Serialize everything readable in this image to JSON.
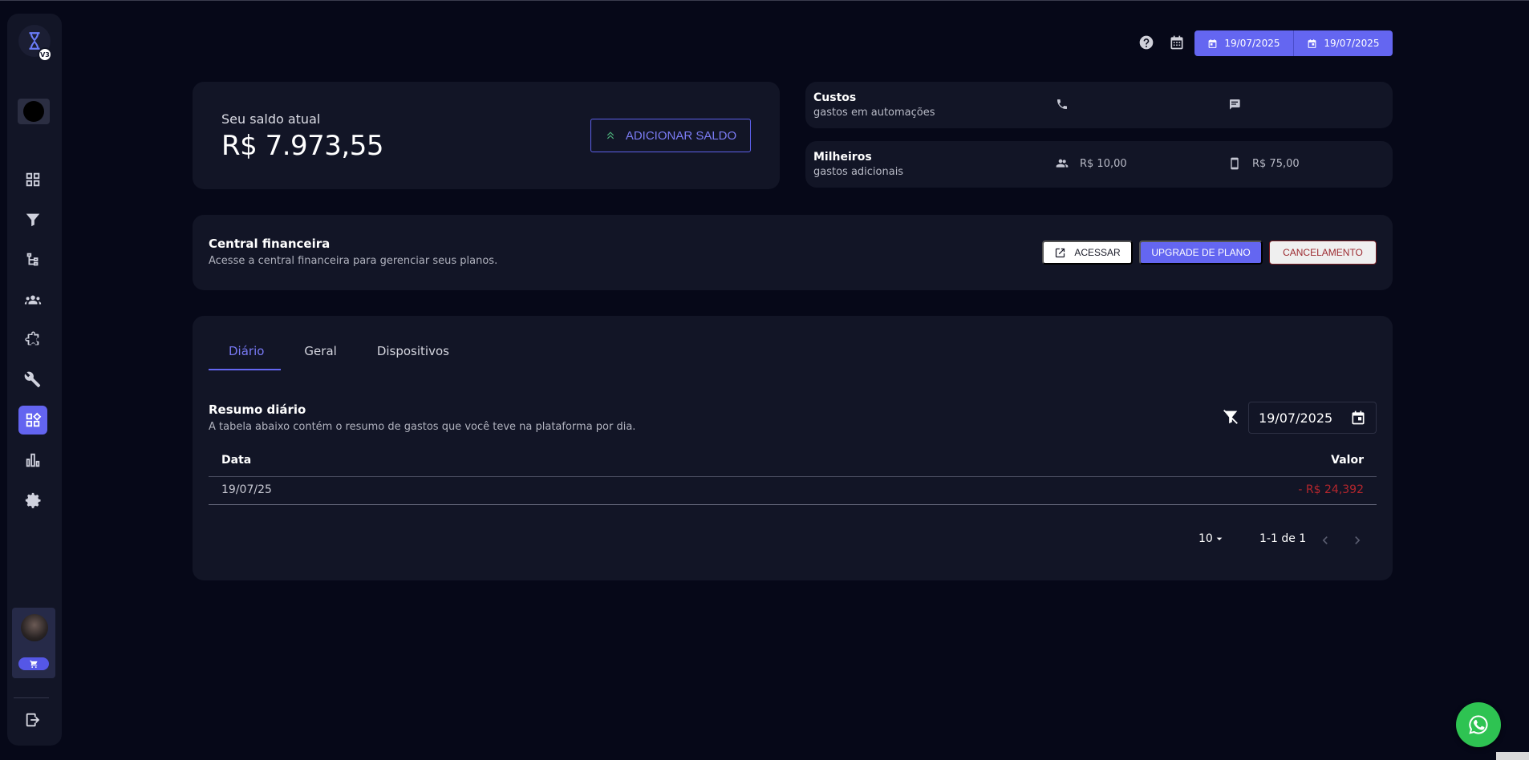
{
  "sidebar": {
    "logo_badge": "V3",
    "workspace_label": "",
    "nav": [
      {
        "icon": "dashboard-icon",
        "active": false
      },
      {
        "icon": "filter-icon",
        "active": false
      },
      {
        "icon": "flow-icon",
        "active": false
      },
      {
        "icon": "groups-icon",
        "active": false
      },
      {
        "icon": "extension-icon",
        "active": false
      },
      {
        "icon": "build-icon",
        "active": false
      },
      {
        "icon": "widgets-icon",
        "active": true
      },
      {
        "icon": "bar-chart-icon",
        "active": false
      },
      {
        "icon": "settings-icon",
        "active": false
      }
    ]
  },
  "toolbar": {
    "date_start": "19/07/2025",
    "date_end": "19/07/2025"
  },
  "balance": {
    "label": "Seu saldo atual",
    "value": "R$ 7.973,55",
    "add_button": "ADICIONAR SALDO"
  },
  "costs": [
    {
      "title": "Custos",
      "subtitle": "gastos em automações",
      "col1_icon": "phone-icon",
      "col1_value": "",
      "col2_icon": "message-icon",
      "col2_value": ""
    },
    {
      "title": "Milheiros",
      "subtitle": "gastos adicionais",
      "col1_icon": "people-icon",
      "col1_value": "R$ 10,00",
      "col2_icon": "smartphone-icon",
      "col2_value": "R$ 75,00"
    }
  ],
  "finance": {
    "title": "Central financeira",
    "subtitle": "Acesse a central financeira para gerenciar seus planos.",
    "access_button": "ACESSAR",
    "upgrade_button": "UPGRADE DE PLANO",
    "cancel_button": "CANCELAMENTO"
  },
  "tabs": [
    "Diário",
    "Geral",
    "Dispositivos"
  ],
  "summary": {
    "title": "Resumo diário",
    "subtitle": "A tabela abaixo contém o resumo de gastos que você teve na plataforma por dia.",
    "date_filter": "19/07/2025",
    "columns": [
      "Data",
      "Valor"
    ],
    "rows": [
      {
        "date": "19/07/25",
        "value": "- R$ 24,392"
      }
    ],
    "rows_per_page": "10",
    "page_info": "1-1 de 1"
  },
  "colors": {
    "accent": "#6466f1",
    "negative": "#b3262d",
    "whatsapp": "#2ec352"
  }
}
